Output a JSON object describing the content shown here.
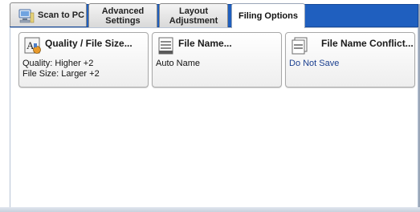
{
  "tabs": [
    {
      "label": "Scan to PC"
    },
    {
      "label": "Advanced\nSettings"
    },
    {
      "label": "Layout\nAdjustment"
    },
    {
      "label": "Filing Options"
    }
  ],
  "options": {
    "quality": {
      "title": "Quality / File Size...",
      "line1": "Quality: Higher +2",
      "line2": "File Size: Larger +2"
    },
    "filename": {
      "title": "File Name...",
      "value": "Auto Name"
    },
    "conflict": {
      "title": "File Name Conflict...",
      "value": "Do Not Save"
    }
  },
  "colors": {
    "tab_bar": "#1f5fbf",
    "value_blue": "#1a3f8f"
  }
}
